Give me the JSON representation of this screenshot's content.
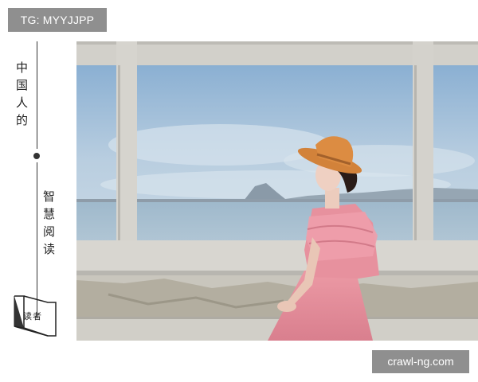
{
  "watermark_top": "TG: MYYJJPP",
  "watermark_bottom": "crawl-ng.com",
  "sidebar": {
    "column_one": [
      "中",
      "国",
      "人",
      "的"
    ],
    "column_two": [
      "智",
      "慧",
      "阅",
      "读"
    ],
    "logo_text": "读者"
  },
  "photo": {
    "subject": "woman in pink dress and straw hat by window frame overlooking sea"
  },
  "colors": {
    "sky": "#a9c4dc",
    "dress": "#e58c9a",
    "hat": "#d9893a",
    "concrete": "#cfcdc7",
    "watermark_bg": "#8f8f8f"
  }
}
